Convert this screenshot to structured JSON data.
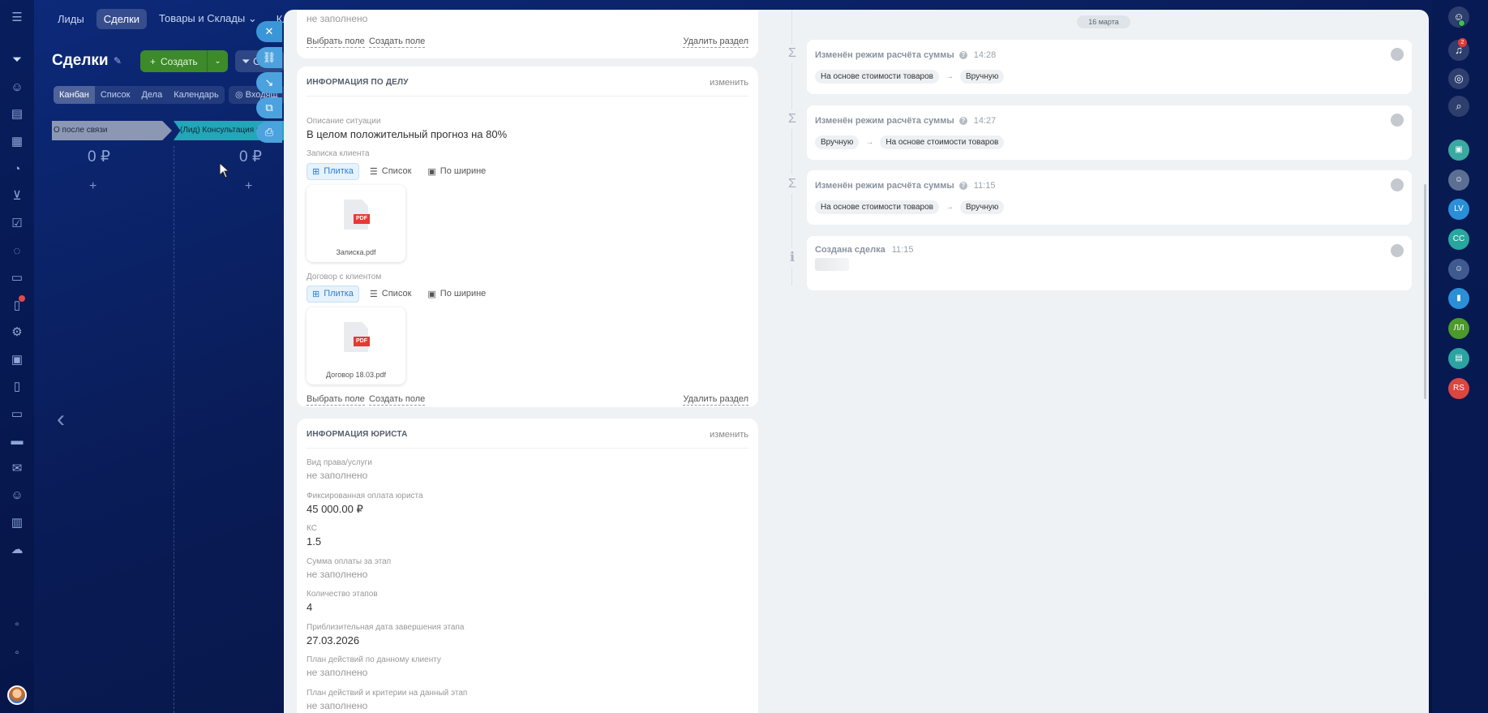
{
  "topnav": {
    "items": [
      "Лиды",
      "Сделки",
      "Товары и Склады",
      "Кл"
    ],
    "active": 1
  },
  "page": {
    "title": "Сделки",
    "create_label": "Создать",
    "filter_short": "С"
  },
  "views": [
    "Канбан",
    "Список",
    "Дела",
    "Календарь"
  ],
  "view_extra": "Входящ",
  "stages": [
    {
      "name": "О после связи",
      "sum": "0 ₽",
      "color": "#8c98b3"
    },
    {
      "name": "(Лид) Консультация на",
      "sum": "0 ₽",
      "color": "#24a6b8"
    }
  ],
  "left_badge": "",
  "card_top": {
    "empty_value": "не заполнено",
    "select_field": "Выбрать поле",
    "create_field": "Создать поле",
    "delete_section": "Удалить раздел"
  },
  "case_info": {
    "title": "ИНФОРМАЦИЯ ПО ДЕЛУ",
    "edit": "изменить",
    "situation_label": "Описание ситуации",
    "situation_value": "В целом положительный прогноз на 80%",
    "note_label": "Записка клиента",
    "tabs": [
      "Плитка",
      "Список",
      "По ширине"
    ],
    "note_file": "Записка.pdf",
    "contract_label": "Договор с клиентом",
    "contract_file": "Договор 18.03.pdf",
    "pdf_badge": "PDF",
    "select_field": "Выбрать поле",
    "create_field": "Создать поле",
    "delete_section": "Удалить раздел"
  },
  "lawyer_info": {
    "title": "ИНФОРМАЦИЯ ЮРИСТА",
    "edit": "изменить",
    "fields": [
      {
        "label": "Вид права/услуги",
        "value": "не заполнено",
        "empty": true
      },
      {
        "label": "Фиксированная оплата юриста",
        "value": "45 000.00 ₽",
        "empty": false
      },
      {
        "label": "КС",
        "value": "1.5",
        "empty": false
      },
      {
        "label": "Сумма оплаты за этап",
        "value": "не заполнено",
        "empty": true
      },
      {
        "label": "Количество этапов",
        "value": "4",
        "empty": false
      },
      {
        "label": "Приблизительная дата завершения этапа",
        "value": "27.03.2026",
        "empty": false
      },
      {
        "label": "План действий по данному клиенту",
        "value": "не заполнено",
        "empty": true
      },
      {
        "label": "План действий и критерии на данный этап",
        "value": "не заполнено",
        "empty": true
      }
    ]
  },
  "timeline": {
    "date": "16 марта",
    "events": [
      {
        "title": "Изменён режим расчёта суммы",
        "time": "14:28",
        "from": "На основе стоимости товаров",
        "to": "Вручную"
      },
      {
        "title": "Изменён режим расчёта суммы",
        "time": "14:27",
        "from": "Вручную",
        "to": "На основе стоимости товаров"
      },
      {
        "title": "Изменён режим расчёта суммы",
        "time": "11:15",
        "from": "На основе стоимости товаров",
        "to": "Вручную"
      },
      {
        "title": "Создана сделка",
        "time": "11:15"
      }
    ]
  },
  "rightbar": {
    "notif_count": "2",
    "avatars": [
      "LV",
      "CC",
      "ЛЛ",
      "RS"
    ]
  },
  "colors": {
    "accent": "#3a96d8",
    "create": "#3c8a2a",
    "bg": "#0b1a52"
  }
}
